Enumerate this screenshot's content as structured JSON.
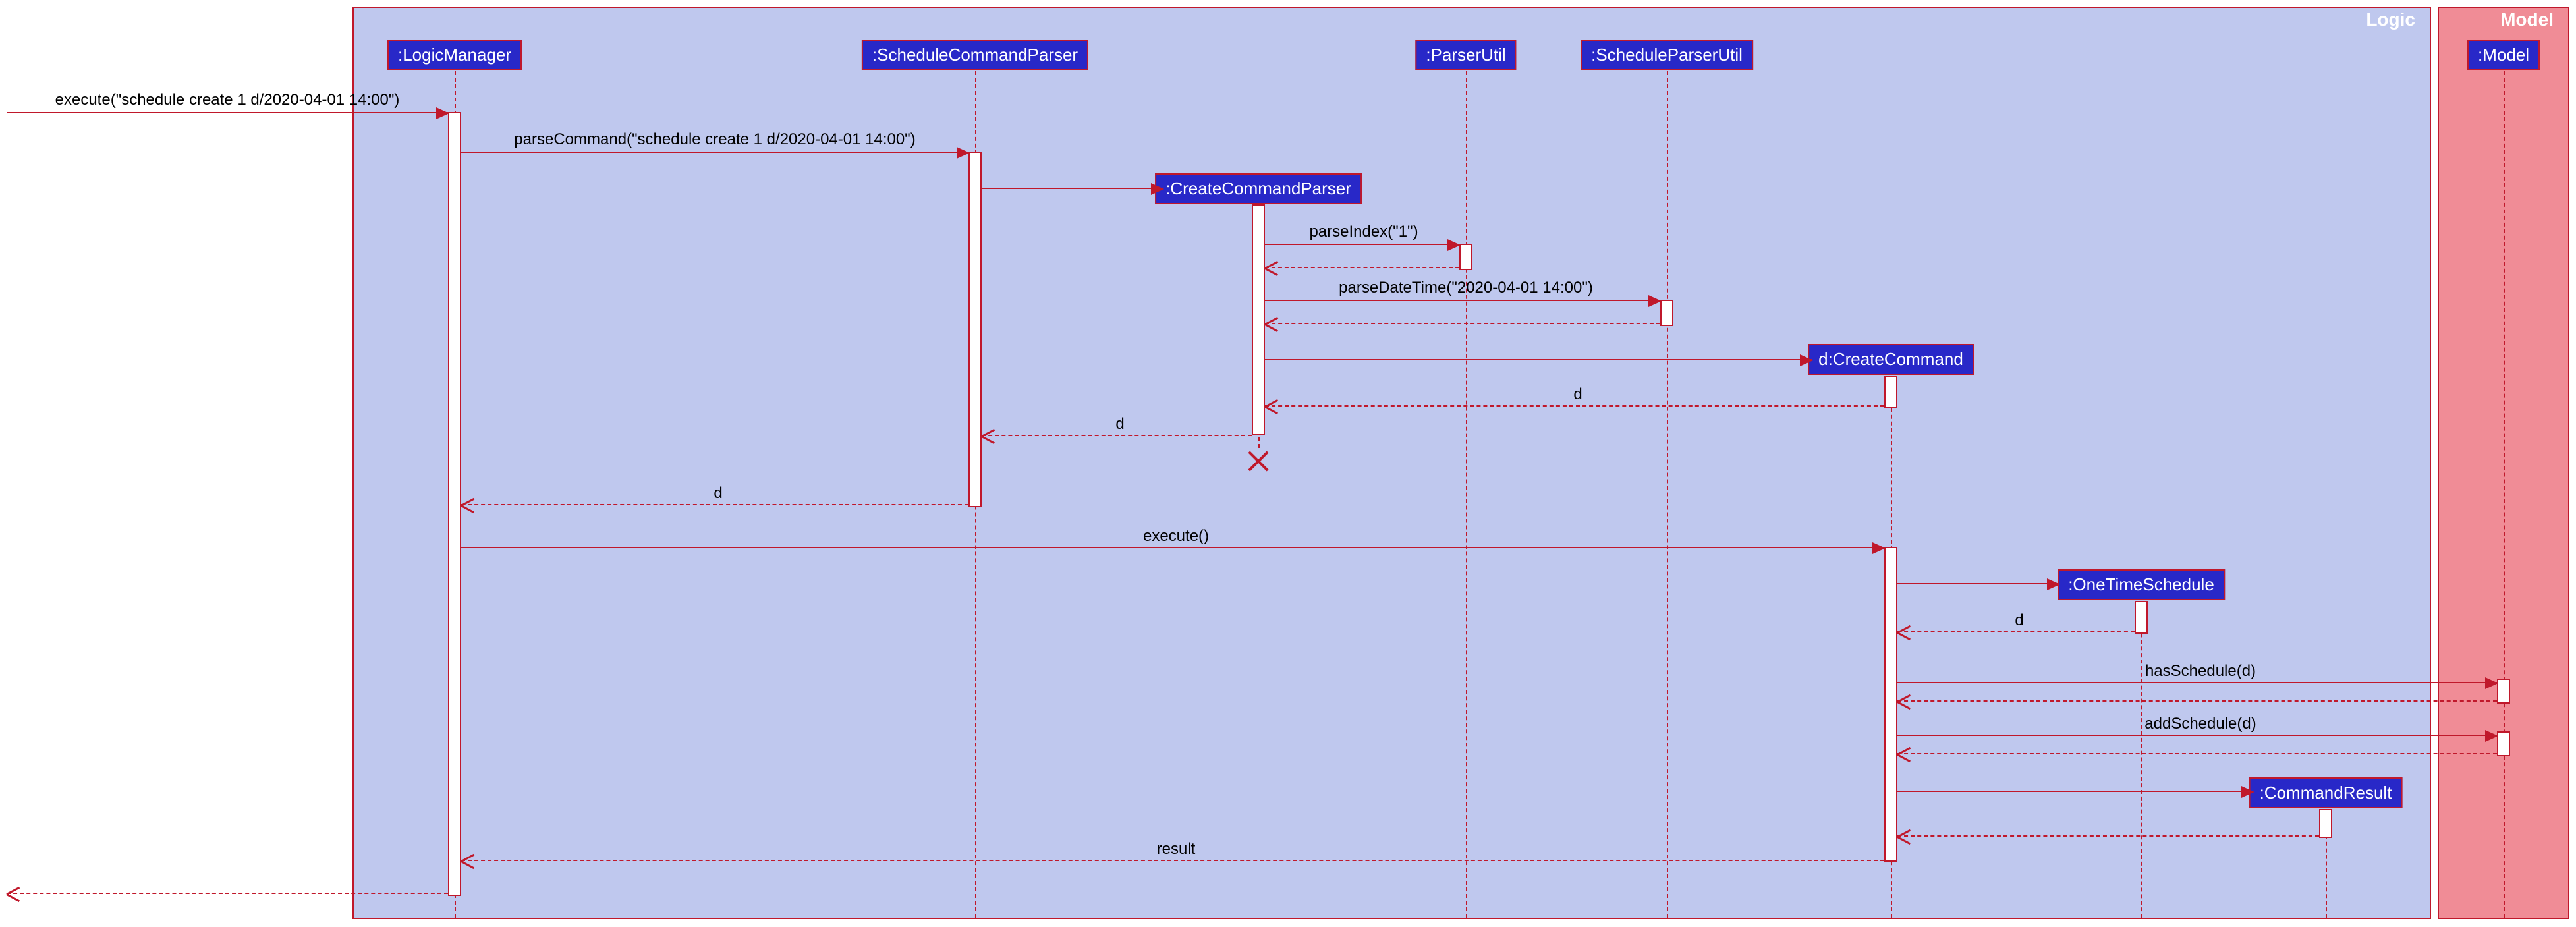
{
  "frames": {
    "logic": {
      "label": "Logic"
    },
    "model": {
      "label": "Model"
    }
  },
  "participants": {
    "logicManager": ":LogicManager",
    "scheduleCommandParser": ":ScheduleCommandParser",
    "createCommandParser": ":CreateCommandParser",
    "parserUtil": ":ParserUtil",
    "scheduleParserUtil": ":ScheduleParserUtil",
    "createCommand": "d:CreateCommand",
    "oneTimeSchedule": ":OneTimeSchedule",
    "commandResult": ":CommandResult",
    "model": ":Model"
  },
  "messages": {
    "m1": "execute(\"schedule create 1 d/2020-04-01 14:00\")",
    "m2": "parseCommand(\"schedule create 1 d/2020-04-01 14:00\")",
    "m3": "parseIndex(\"1\")",
    "m4": "parseDateTime(\"2020-04-01 14:00\")",
    "m5": "d",
    "m6": "d",
    "m7": "d",
    "m8": "execute()",
    "m9": "d",
    "m10": "hasSchedule(d)",
    "m11": "addSchedule(d)",
    "m12": "result"
  },
  "chart_data": {
    "type": "sequence-diagram",
    "frames": [
      {
        "name": "Logic",
        "contains": [
          "LogicManager",
          "ScheduleCommandParser",
          "CreateCommandParser",
          "ParserUtil",
          "ScheduleParserUtil",
          "CreateCommand",
          "OneTimeSchedule",
          "CommandResult"
        ]
      },
      {
        "name": "Model",
        "contains": [
          "Model"
        ]
      }
    ],
    "participants": [
      {
        "id": "caller",
        "label": "(external)",
        "lifeline": true
      },
      {
        "id": "LogicManager",
        "label": ":LogicManager"
      },
      {
        "id": "ScheduleCommandParser",
        "label": ":ScheduleCommandParser"
      },
      {
        "id": "CreateCommandParser",
        "label": ":CreateCommandParser",
        "created_by_msg": 2,
        "destroyed": true
      },
      {
        "id": "ParserUtil",
        "label": ":ParserUtil"
      },
      {
        "id": "ScheduleParserUtil",
        "label": ":ScheduleParserUtil"
      },
      {
        "id": "CreateCommand",
        "label": "d:CreateCommand",
        "created_by_msg": 6
      },
      {
        "id": "OneTimeSchedule",
        "label": ":OneTimeSchedule",
        "created_by_msg": 10
      },
      {
        "id": "CommandResult",
        "label": ":CommandResult",
        "created_by_msg": 15
      },
      {
        "id": "Model",
        "label": ":Model"
      }
    ],
    "messages": [
      {
        "n": 1,
        "from": "caller",
        "to": "LogicManager",
        "label": "execute(\"schedule create 1 d/2020-04-01 14:00\")",
        "kind": "sync"
      },
      {
        "n": 2,
        "from": "LogicManager",
        "to": "ScheduleCommandParser",
        "label": "parseCommand(\"schedule create 1 d/2020-04-01 14:00\")",
        "kind": "sync"
      },
      {
        "n": 3,
        "from": "ScheduleCommandParser",
        "to": "CreateCommandParser",
        "label": "",
        "kind": "create"
      },
      {
        "n": 4,
        "from": "CreateCommandParser",
        "to": "ParserUtil",
        "label": "parseIndex(\"1\")",
        "kind": "sync"
      },
      {
        "n": 5,
        "from": "ParserUtil",
        "to": "CreateCommandParser",
        "label": "",
        "kind": "return"
      },
      {
        "n": 6,
        "from": "CreateCommandParser",
        "to": "ScheduleParserUtil",
        "label": "parseDateTime(\"2020-04-01 14:00\")",
        "kind": "sync"
      },
      {
        "n": 7,
        "from": "ScheduleParserUtil",
        "to": "CreateCommandParser",
        "label": "",
        "kind": "return"
      },
      {
        "n": 8,
        "from": "CreateCommandParser",
        "to": "CreateCommand",
        "label": "",
        "kind": "create"
      },
      {
        "n": 9,
        "from": "CreateCommand",
        "to": "CreateCommandParser",
        "label": "d",
        "kind": "return"
      },
      {
        "n": 10,
        "from": "CreateCommandParser",
        "to": "ScheduleCommandParser",
        "label": "d",
        "kind": "return"
      },
      {
        "n": 11,
        "from": "ScheduleCommandParser",
        "to": "LogicManager",
        "label": "d",
        "kind": "return"
      },
      {
        "n": 12,
        "from": "LogicManager",
        "to": "CreateCommand",
        "label": "execute()",
        "kind": "sync"
      },
      {
        "n": 13,
        "from": "CreateCommand",
        "to": "OneTimeSchedule",
        "label": "",
        "kind": "create"
      },
      {
        "n": 14,
        "from": "OneTimeSchedule",
        "to": "CreateCommand",
        "label": "d",
        "kind": "return"
      },
      {
        "n": 15,
        "from": "CreateCommand",
        "to": "Model",
        "label": "hasSchedule(d)",
        "kind": "sync"
      },
      {
        "n": 16,
        "from": "Model",
        "to": "CreateCommand",
        "label": "",
        "kind": "return"
      },
      {
        "n": 17,
        "from": "CreateCommand",
        "to": "Model",
        "label": "addSchedule(d)",
        "kind": "sync"
      },
      {
        "n": 18,
        "from": "Model",
        "to": "CreateCommand",
        "label": "",
        "kind": "return"
      },
      {
        "n": 19,
        "from": "CreateCommand",
        "to": "CommandResult",
        "label": "",
        "kind": "create"
      },
      {
        "n": 20,
        "from": "CommandResult",
        "to": "CreateCommand",
        "label": "",
        "kind": "return"
      },
      {
        "n": 21,
        "from": "CreateCommand",
        "to": "LogicManager",
        "label": "result",
        "kind": "return"
      },
      {
        "n": 22,
        "from": "LogicManager",
        "to": "caller",
        "label": "",
        "kind": "return"
      }
    ]
  }
}
